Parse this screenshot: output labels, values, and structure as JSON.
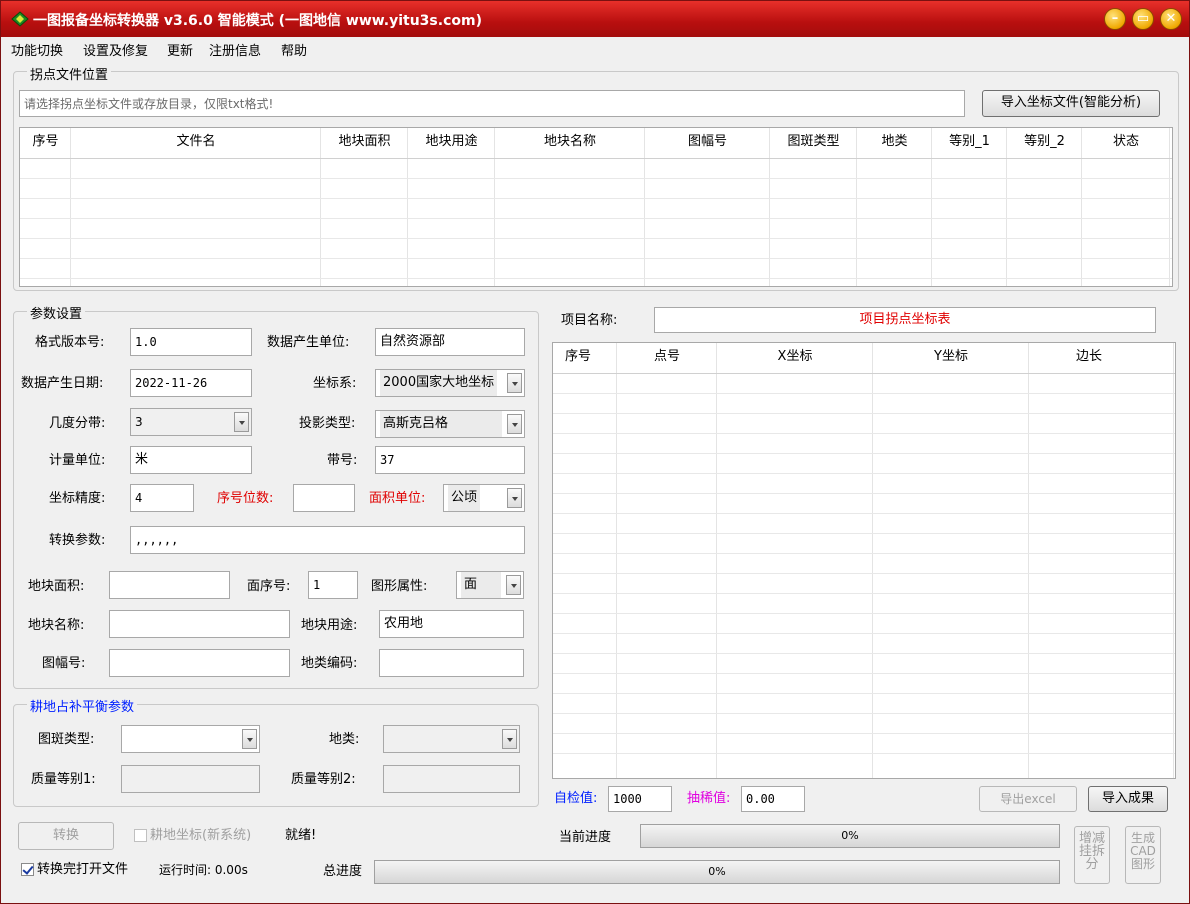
{
  "window": {
    "title": "一图报备坐标转换器 v3.6.0 智能模式  (一图地信 www.yitu3s.com)",
    "minimize": "–",
    "maximize": "▭",
    "close": "✕"
  },
  "menu": [
    "功能切换",
    "设置及修复",
    "更新",
    "注册信息",
    "帮助"
  ],
  "file_group": {
    "label": "拐点文件位置",
    "path_placeholder": "请选择拐点坐标文件或存放目录，仅限txt格式!",
    "import_button": "导入坐标文件(智能分析)",
    "columns": [
      "序号",
      "文件名",
      "地块面积",
      "地块用途",
      "地块名称",
      "图幅号",
      "图斑类型",
      "地类",
      "等别_1",
      "等别_2",
      "状态"
    ]
  },
  "params": {
    "label": "参数设置",
    "format_version_label": "格式版本号:",
    "format_version": "1.0",
    "data_unit_label": "数据产生单位:",
    "data_unit": "自然资源部",
    "data_date_label": "数据产生日期:",
    "data_date": "2022-11-26",
    "coord_sys_label": "坐标系:",
    "coord_sys": "2000国家大地坐标",
    "zone_type_label": "几度分带:",
    "zone_type": "3",
    "projection_label": "投影类型:",
    "projection": "高斯克吕格",
    "unit_label": "计量单位:",
    "unit": "米",
    "zone_no_label": "带号:",
    "zone_no": "37",
    "precision_label": "坐标精度:",
    "precision": "4",
    "seq_digits_label": "序号位数:",
    "seq_digits": "",
    "area_unit_label": "面积单位:",
    "area_unit": "公顷",
    "transform_label": "转换参数:",
    "transform": ",,,,,,",
    "parcel_area_label": "地块面积:",
    "parcel_area": "",
    "face_no_label": "面序号:",
    "face_no": "1",
    "shape_attr_label": "图形属性:",
    "shape_attr": "面",
    "parcel_name_label": "地块名称:",
    "parcel_name": "",
    "parcel_use_label": "地块用途:",
    "parcel_use": "农用地",
    "sheet_no_label": "图幅号:",
    "sheet_no": "",
    "landclass_code_label": "地类编码:",
    "landclass_code": ""
  },
  "balance": {
    "label": "耕地占补平衡参数",
    "patch_type_label": "图斑类型:",
    "patch_type": "",
    "landclass_label": "地类:",
    "landclass": "",
    "quality1_label": "质量等别1:",
    "quality1": "",
    "quality2_label": "质量等别2:",
    "quality2": ""
  },
  "project": {
    "name_label": "项目名称:",
    "name": "项目拐点坐标表",
    "columns": [
      "序号",
      "点号",
      "X坐标",
      "Y坐标",
      "边长"
    ],
    "self_check_label": "自检值:",
    "self_check": "1000",
    "thin_label": "抽稀值:",
    "thin": "0.00",
    "export_excel": "导出excel",
    "import_result": "导入成果"
  },
  "bottom": {
    "convert_button": "转换",
    "farmland_checkbox": "耕地坐标(新系统)",
    "status": "就绪!",
    "open_after_checkbox": "转换完打开文件",
    "run_time": "运行时间: 0.00s",
    "current_progress_label": "当前进度",
    "current_progress_text": "0%",
    "current_progress_value": 0,
    "total_progress_label": "总进度",
    "total_progress_text": "0%",
    "total_progress_value": 0,
    "split_button": "增减挂拆分",
    "cad_button": "生成CAD图形"
  }
}
